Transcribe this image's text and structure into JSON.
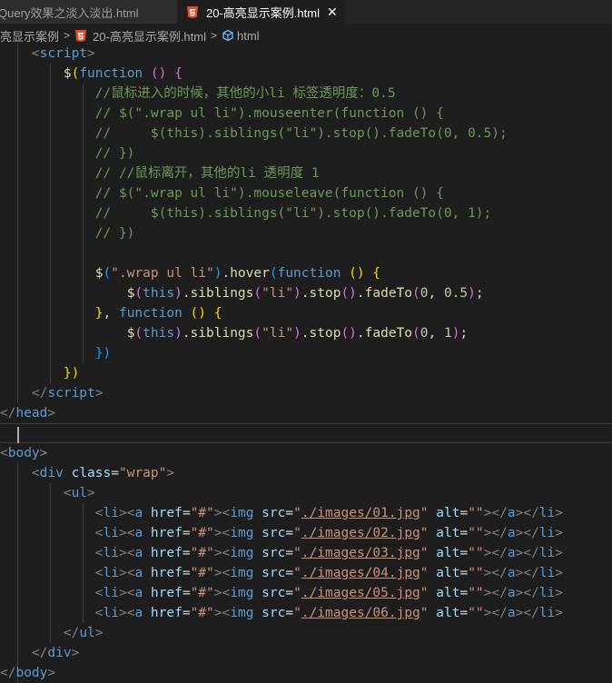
{
  "tabs": [
    {
      "label": "Query效果之淡入淡出.html",
      "active": false
    },
    {
      "label": "20-高亮显示案例.html",
      "active": true
    }
  ],
  "tab_close_glyph": "✕",
  "breadcrumb": {
    "segments": [
      "亮显示案例",
      "20-高亮显示案例.html",
      "html"
    ],
    "separator": ">"
  },
  "code": {
    "comment1": "//鼠标进入的时候，其他的小li 标签透明度：0.5",
    "comment2": "// $(\".wrap ul li\").mouseenter(function () {",
    "comment3": "//     $(this).siblings(\"li\").stop().fadeTo(0, 0.5);",
    "comment4": "// })",
    "comment5": "// //鼠标离开，其他的li 透明度 1",
    "comment6": "// $(\".wrap ul li\").mouseleave(function () {",
    "comment7": "//     $(this).siblings(\"li\").stop().fadeTo(0, 1);",
    "comment8": "// })",
    "selector": "\".wrap ul li\"",
    "hover": "hover",
    "fn_kw": "function",
    "this_kw": "this",
    "siblings": "siblings",
    "li_str": "\"li\"",
    "stop": "stop",
    "fadeTo": "fadeTo",
    "zero": "0",
    "half": "0.5",
    "one": "1",
    "script_tag": "script",
    "head_tag": "head",
    "body_tag": "body",
    "div_tag": "div",
    "ul_tag": "ul",
    "class_attr": "class",
    "class_val": "\"wrap\"",
    "dollar": "$",
    "img_srcs": [
      "./images/01.jpg",
      "./images/02.jpg",
      "./images/03.jpg",
      "./images/04.jpg",
      "./images/05.jpg",
      "./images/06.jpg"
    ]
  },
  "colors": {
    "background": "#1e1e1e",
    "tag": "#569cd6",
    "attr": "#9cdcfe",
    "string": "#ce9178",
    "comment": "#6a9955",
    "function": "#dcdcaa",
    "number": "#b5cea8",
    "html5_badge": "#e44d26"
  }
}
